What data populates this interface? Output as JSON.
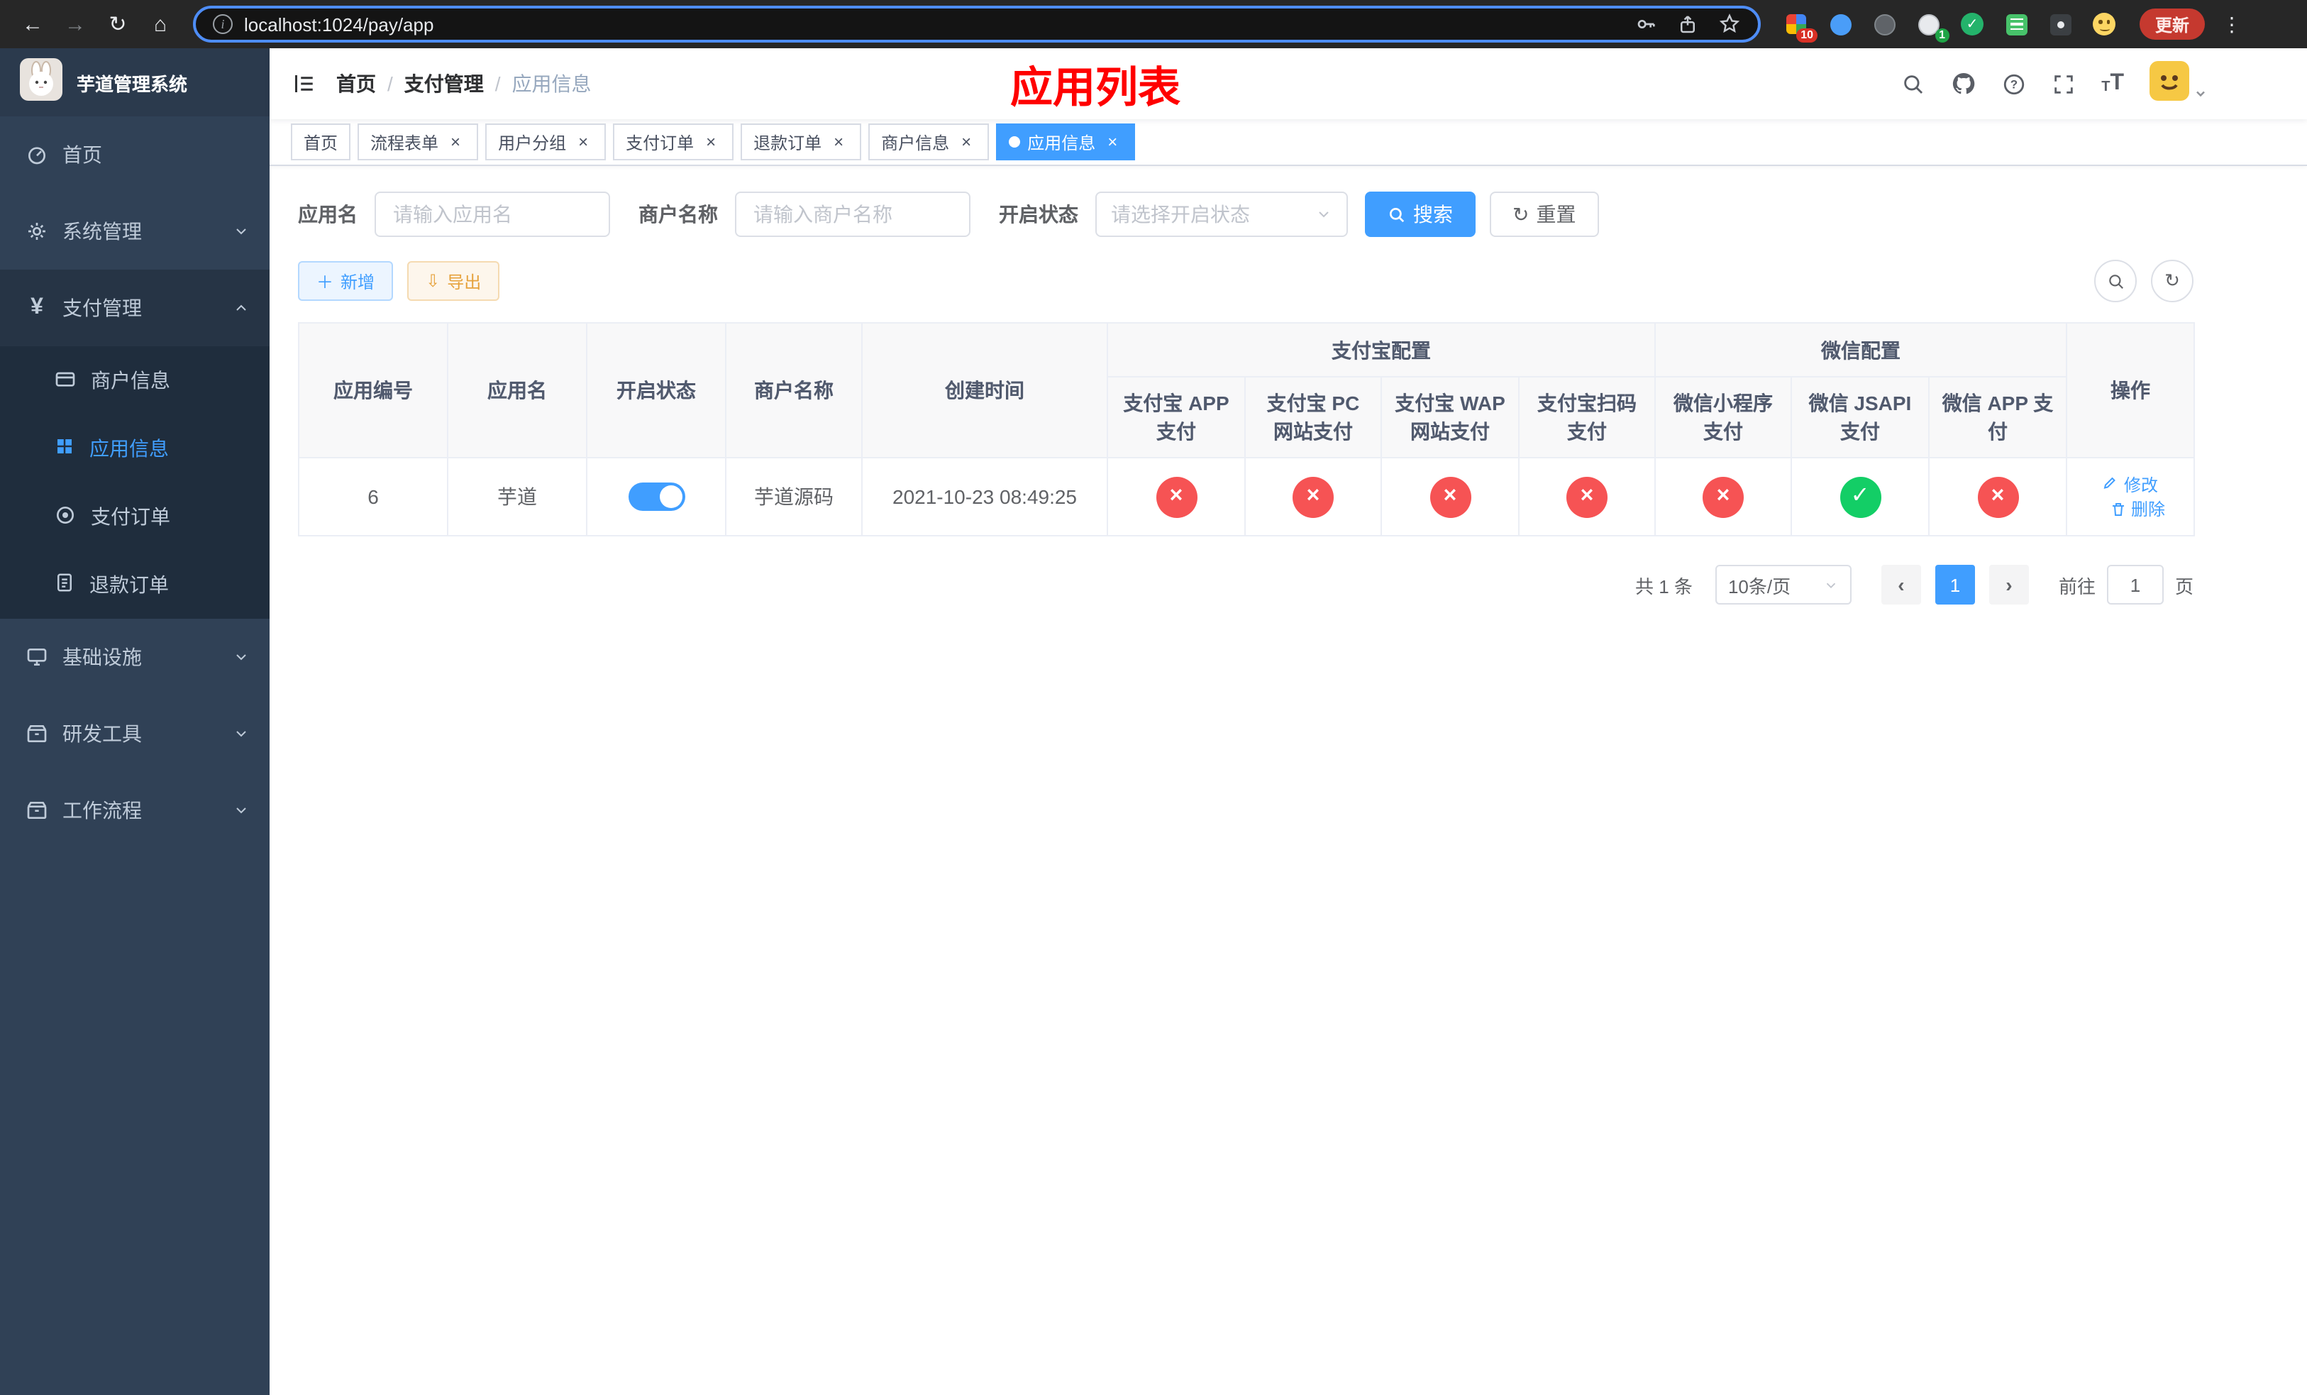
{
  "colors": {
    "accent": "#409eff",
    "danger": "#f65354",
    "success": "#13ce66",
    "title_red": "#ff0000",
    "warning": "#e6a23c"
  },
  "browser": {
    "url": "localhost:1024/pay/app",
    "update_label": "更新",
    "badges": {
      "extensions": "10",
      "notifications": "1"
    }
  },
  "sidebar": {
    "logo_title": "芋道管理系统",
    "items": [
      {
        "label": "首页"
      },
      {
        "label": "系统管理"
      },
      {
        "label": "支付管理",
        "children": [
          {
            "label": "商户信息"
          },
          {
            "label": "应用信息"
          },
          {
            "label": "支付订单"
          },
          {
            "label": "退款订单"
          }
        ]
      },
      {
        "label": "基础设施"
      },
      {
        "label": "研发工具"
      },
      {
        "label": "工作流程"
      }
    ]
  },
  "header": {
    "breadcrumb": [
      "首页",
      "支付管理",
      "应用信息"
    ],
    "sep": "/",
    "page_title": "应用列表"
  },
  "tabs": [
    {
      "label": "首页"
    },
    {
      "label": "流程表单"
    },
    {
      "label": "用户分组"
    },
    {
      "label": "支付订单"
    },
    {
      "label": "退款订单"
    },
    {
      "label": "商户信息"
    },
    {
      "label": "应用信息"
    }
  ],
  "filters": {
    "app_name_label": "应用名",
    "app_name_placeholder": "请输入应用名",
    "merchant_label": "商户名称",
    "merchant_placeholder": "请输入商户名称",
    "status_label": "开启状态",
    "status_placeholder": "请选择开启状态",
    "search_label": "搜索",
    "reset_label": "重置"
  },
  "toolbar": {
    "add_label": "新增",
    "export_label": "导出"
  },
  "table": {
    "columns": {
      "id": "应用编号",
      "name": "应用名",
      "status": "开启状态",
      "merchant": "商户名称",
      "created": "创建时间",
      "actions": "操作"
    },
    "groups": {
      "alipay": {
        "title": "支付宝配置",
        "cols": [
          "支付宝 APP 支付",
          "支付宝 PC 网站支付",
          "支付宝 WAP 网站支付",
          "支付宝扫码支付"
        ]
      },
      "wechat": {
        "title": "微信配置",
        "cols": [
          "微信小程序支付",
          "微信 JSAPI 支付",
          "微信 APP 支付"
        ]
      }
    },
    "row": {
      "id": "6",
      "name": "芋道",
      "status_on": true,
      "merchant": "芋道源码",
      "created": "2021-10-23 08:49:25",
      "configs": [
        false,
        false,
        false,
        false,
        false,
        true,
        false
      ],
      "edit": "修改",
      "delete": "删除"
    }
  },
  "pagination": {
    "total": "共 1 条",
    "size": "10条/页",
    "page": "1",
    "goto": "前往",
    "goto_value": "1",
    "unit": "页"
  }
}
